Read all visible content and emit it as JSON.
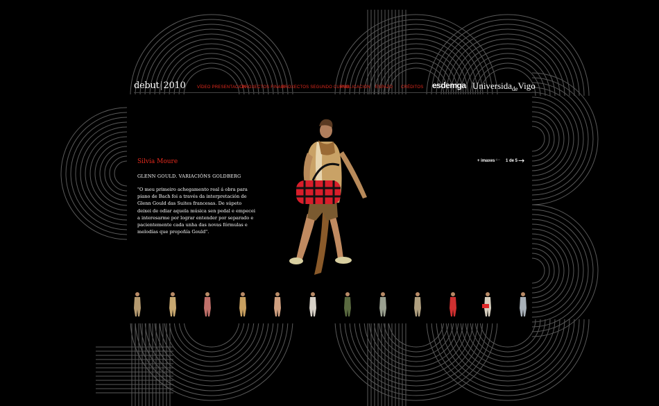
{
  "brand": {
    "logo_left": "debut",
    "logo_sep": "|",
    "logo_right": "2010"
  },
  "nav": [
    {
      "label": "VÍDEO PRESENTACIÓN"
    },
    {
      "label": "PROXECTOS FINAIS"
    },
    {
      "label": "PROXECTOS SEGUNDO CURSO"
    },
    {
      "label": "PUBLICACIÓN"
    },
    {
      "label": "ESPAZO"
    },
    {
      "label": "CRÉDITOS"
    }
  ],
  "partners": {
    "esdemga": "esdemga",
    "uvigo_a": "Universida",
    "uvigo_de": "de",
    "uvigo_b": "Vigo"
  },
  "project": {
    "artist": "Silvia Moure",
    "title": "GLENN GOULD. VARIACIÓNS GOLDBERG",
    "quote": "\"O meu primeiro achegamento real á obra para piano de Bach foi a través da interpretación de Glenn Gould das Suites francesas. De súpeto deixei de odiar aquela música sen pedal e empecei a interesarme por lograr entender por separado e pacientemente cada unha das novas fórmulas e melodías que propoñía Gould\"."
  },
  "gallery": {
    "more_label": "+ imaxes",
    "prev_glyph": "←",
    "next_glyph": "→",
    "counter": "1 de 5",
    "thumbnail_count": 12,
    "selected_thumbnail": 10
  },
  "colors": {
    "accent": "#e52a1d",
    "background": "#000000",
    "text": "#ffffff",
    "lines": "#5a5a5a"
  },
  "background_text": "2010"
}
